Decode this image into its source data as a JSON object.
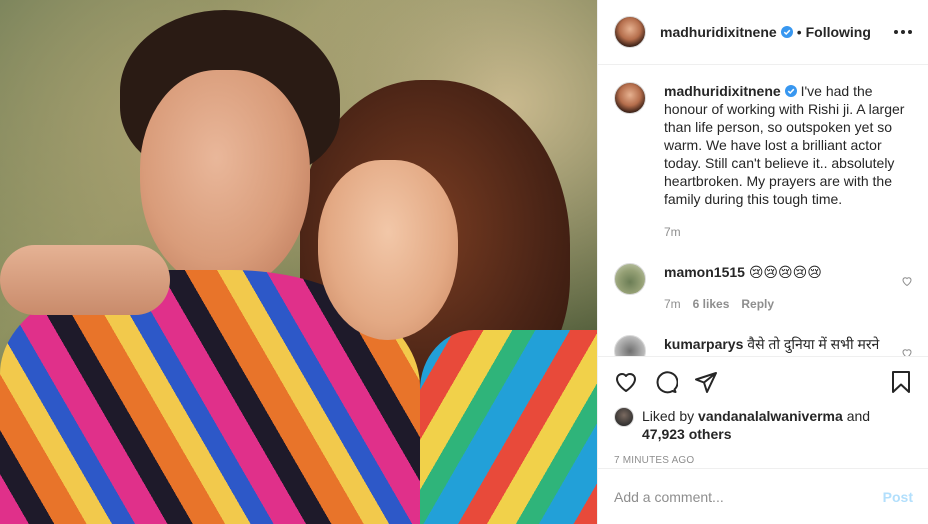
{
  "post": {
    "author": "madhuridixitnene",
    "follow_separator": "•",
    "follow_state": "Following",
    "caption": "I've had the honour of working with Rishi ji. A larger than life person, so outspoken yet so warm. We have lost a brilliant actor today. Still can't believe it.. absolutely heartbroken. My prayers are with the family during this tough time.",
    "caption_time": "7m",
    "photo_icon": "post-photo"
  },
  "comments": [
    {
      "user": "mamon1515",
      "text": "😢😢😢😢😢",
      "time": "7m",
      "likes": "6 likes",
      "reply": "Reply"
    },
    {
      "user": "kumarparys",
      "text": "वैसे तो दुनिया में सभी मरने"
    }
  ],
  "actions": {
    "like_icon": "heart-icon",
    "comment_icon": "comment-icon",
    "share_icon": "share-icon",
    "save_icon": "bookmark-icon"
  },
  "liked_by": {
    "prefix": "Liked by",
    "user": "vandanalalwaniverma",
    "and": "and",
    "others": "47,923 others"
  },
  "timestamp": "7 MINUTES AGO",
  "add_comment": {
    "placeholder": "Add a comment...",
    "post_label": "Post"
  },
  "colors": {
    "verified": "#3897f0",
    "post_disabled": "#b2dffc",
    "muted": "#8e8e8e",
    "text": "#262626"
  }
}
